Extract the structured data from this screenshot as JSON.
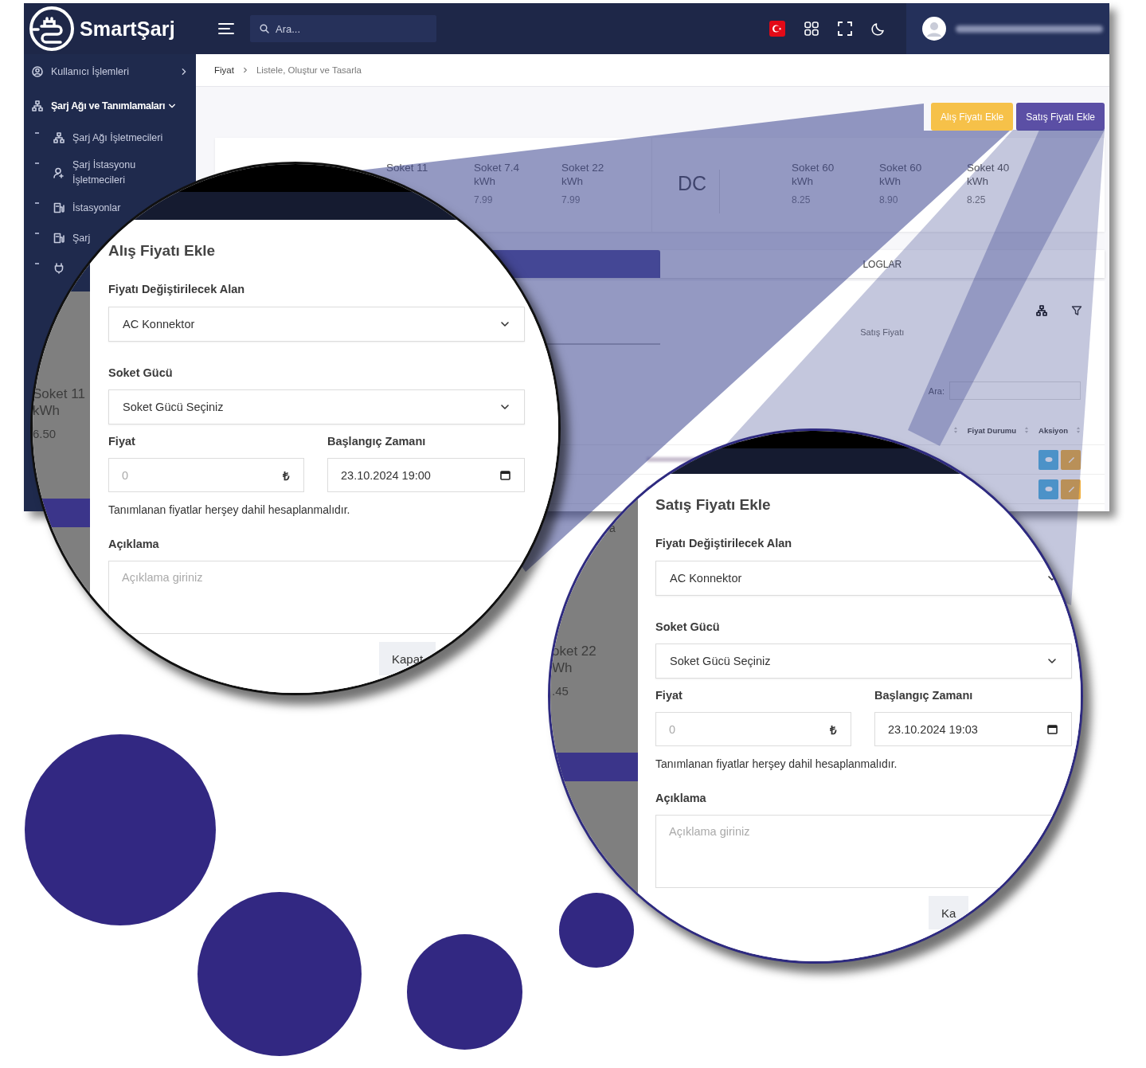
{
  "app": {
    "brand": "SmartŞarj",
    "search": {
      "placeholder": "Ara..."
    },
    "sidebar": {
      "items": [
        {
          "label": "Kullanıcı İşlemleri",
          "expanded": false
        },
        {
          "label": "Şarj Ağı ve Tanımlamaları",
          "expanded": true,
          "children": [
            {
              "kind": "link",
              "label": "Şarj Ağı İşletmecileri"
            },
            {
              "kind": "link",
              "label": "Şarj İstasyonu İşletmecileri"
            },
            {
              "kind": "link",
              "label": "İstasyonlar"
            },
            {
              "kind": "link",
              "label": "Şarj"
            },
            {
              "kind": "icon"
            }
          ]
        }
      ]
    },
    "breadcrumb": [
      "Fiyat",
      "Listele, Oluştur ve Tasarla"
    ],
    "actions": [
      {
        "label": "Alış Fiyatı Ekle",
        "kind": "warning"
      },
      {
        "label": "Satış Fiyatı Ekle",
        "kind": "primary"
      }
    ],
    "price_card": {
      "ac_sockets": [
        {
          "name": "Soket 11"
        },
        {
          "name": "Soket 7.4",
          "unit": "kWh",
          "price": "7.99"
        },
        {
          "name": "Soket 22",
          "unit": "kWh",
          "price": "7.99"
        }
      ],
      "dc_label": "DC",
      "dc_sockets": [
        {
          "name": "Soket 60",
          "unit": "kWh",
          "price": "8.25"
        },
        {
          "name": "Soket 60",
          "unit": "kWh",
          "price": "8.90"
        },
        {
          "name": "Soket 40",
          "unit": "kWh",
          "price": "8.25"
        }
      ]
    },
    "tabs": [
      {
        "selected": true
      },
      {
        "label": "LOGLAR",
        "selected": false
      }
    ],
    "sub_tabs": [
      {
        "selected": true
      },
      {
        "label": "Satış Fiyatı",
        "selected": false
      }
    ],
    "table": {
      "search_label": "Ara:",
      "columns": [
        "Fiyat Durumu",
        "Aksiyon"
      ],
      "rows": [
        {
          "actions": [
            {
              "kind": "view"
            },
            {
              "kind": "edit"
            }
          ]
        },
        {
          "actions": [
            {
              "kind": "view"
            },
            {
              "kind": "edit"
            }
          ]
        }
      ]
    }
  },
  "magnifiers": [
    {
      "kind": "buy",
      "backdrop_texts": [
        "Soket 11",
        "kWh",
        "6.50"
      ],
      "modal": {
        "title": "Alış Fiyatı Ekle",
        "field_label": "Fiyatı Değiştirilecek Alan",
        "field_value": "AC Konnektor",
        "power_label": "Soket Gücü",
        "power_value": "Soket Gücü Seçiniz",
        "price_label": "Fiyat",
        "price_placeholder": "0",
        "currency": "₺",
        "start_label": "Başlangıç Zamanı",
        "start_value": "23.10.2024 19:00",
        "hint": "Tanımlanan fiyatlar herşey dahil hesaplanmalıdır.",
        "note_label": "Açıklama",
        "note_placeholder": "Açıklama giriniz",
        "close": "Kapat"
      }
    },
    {
      "kind": "sell",
      "backdrop_texts": [
        "a",
        "oket 22",
        "Wh",
        ".45"
      ],
      "modal": {
        "title": "Satış Fiyatı Ekle",
        "field_label": "Fiyatı Değiştirilecek Alan",
        "field_value": "AC Konnektor",
        "power_label": "Soket Gücü",
        "power_value": "Soket Gücü Seçiniz",
        "price_label": "Fiyat",
        "price_placeholder": "0",
        "currency": "₺",
        "start_label": "Başlangıç Zamanı",
        "start_value": "23.10.2024 19:03",
        "hint": "Tanımlanan fiyatlar herşey dahil hesaplanmalıdır.",
        "note_label": "Açıklama",
        "note_placeholder": "Açıklama giriniz",
        "close": "Ka"
      }
    }
  ]
}
